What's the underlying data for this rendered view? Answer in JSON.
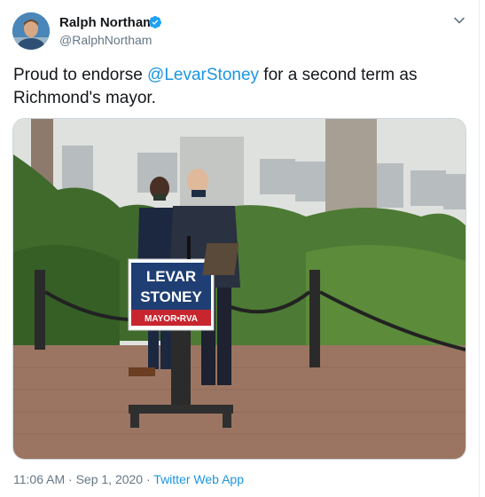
{
  "author": {
    "name": "Ralph Northam",
    "handle": "@RalphNortham",
    "verified": true
  },
  "tweet": {
    "text_before": "Proud to endorse ",
    "mention": "@LevarStoney",
    "text_after": " for a second term as Richmond's mayor."
  },
  "photo": {
    "sign_line1": "LEVAR",
    "sign_line2": "STONEY",
    "sign_line3": "MAYOR•RVA"
  },
  "meta": {
    "time": "11:06 AM",
    "sep1": " · ",
    "date": "Sep 1, 2020",
    "sep2": " · ",
    "source": "Twitter Web App"
  },
  "colors": {
    "accent": "#1b95e0",
    "verified": "#1da1f2",
    "muted": "#657786",
    "sign_blue": "#1f3f74",
    "sign_red": "#c8262f"
  },
  "icons": {
    "verified": "verified-badge-icon",
    "menu": "chevron-down-icon"
  }
}
